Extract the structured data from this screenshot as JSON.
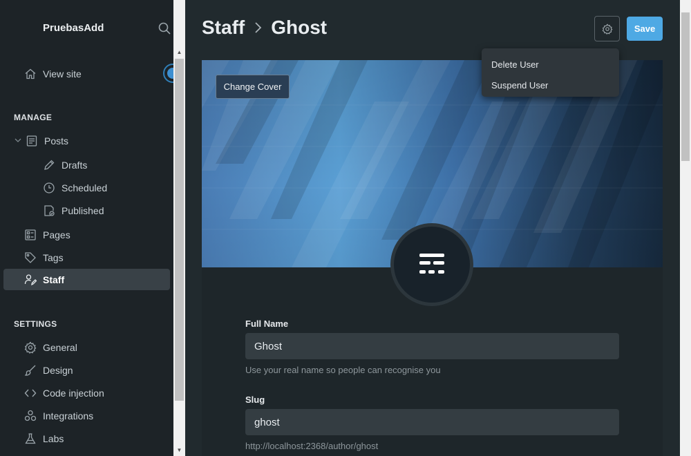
{
  "sidebar": {
    "brand": "PruebasAdd",
    "view_site": "View site",
    "manage_title": "MANAGE",
    "settings_title": "SETTINGS",
    "manage_items": {
      "posts": "Posts",
      "drafts": "Drafts",
      "scheduled": "Scheduled",
      "published": "Published",
      "pages": "Pages",
      "tags": "Tags",
      "staff": "Staff"
    },
    "settings_items": {
      "general": "General",
      "design": "Design",
      "code_injection": "Code injection",
      "integrations": "Integrations",
      "labs": "Labs"
    }
  },
  "header": {
    "breadcrumb_parent": "Staff",
    "breadcrumb_current": "Ghost",
    "save_label": "Save"
  },
  "cover": {
    "change_cover_label": "Change Cover"
  },
  "actions_menu": {
    "delete_user": "Delete User",
    "suspend_user": "Suspend User"
  },
  "form": {
    "full_name_label": "Full Name",
    "full_name_value": "Ghost",
    "full_name_hint": "Use your real name so people can recognise you",
    "slug_label": "Slug",
    "slug_value": "ghost",
    "slug_hint": "http://localhost:2368/author/ghost"
  },
  "colors": {
    "accent": "#4ea9e4",
    "sidebar_bg": "#1d2327",
    "main_bg": "#212a2e",
    "active_item_bg": "#394147"
  }
}
